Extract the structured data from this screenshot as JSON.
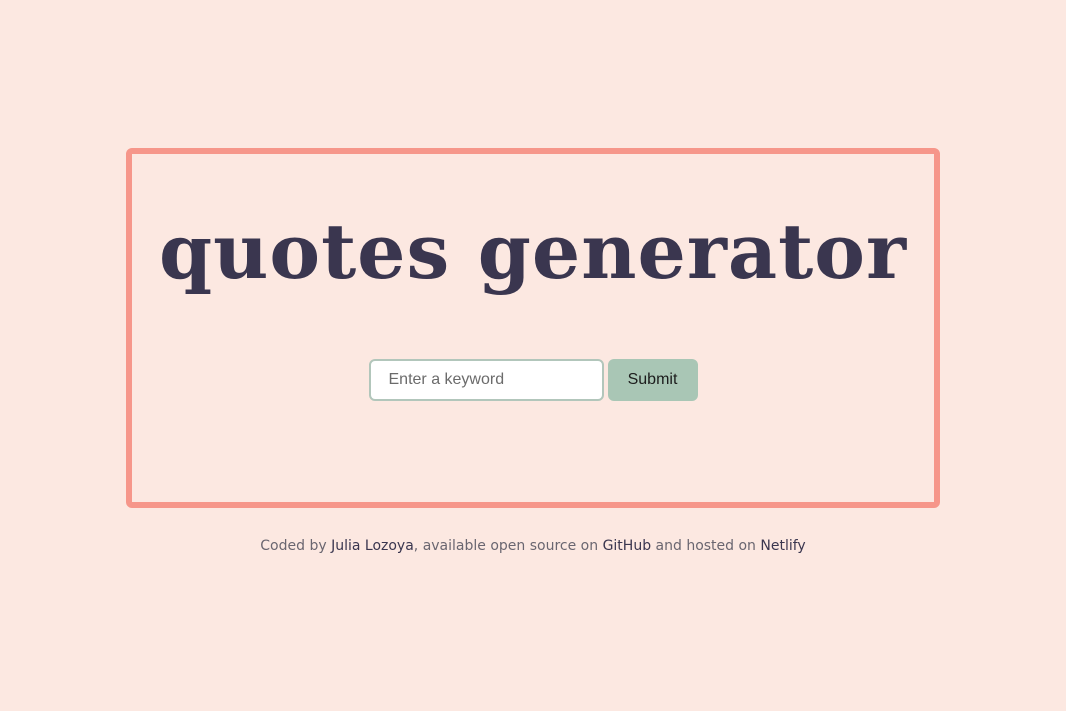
{
  "app": {
    "title": "quotes generator"
  },
  "search": {
    "placeholder": "Enter a keyword",
    "value": "",
    "submit_label": "Submit"
  },
  "footer": {
    "prefix": "Coded by ",
    "author_link": "Julia Lozoya",
    "middle": ", available open source on ",
    "github_link": "GitHub",
    "connector": " and hosted on ",
    "netlify_link": "Netlify"
  },
  "colors": {
    "background": "#fce8e1",
    "frame_border": "#f6968a",
    "title_text": "#3a364f",
    "input_border": "#b2c6bb",
    "submit_background": "#a9c6b5"
  }
}
